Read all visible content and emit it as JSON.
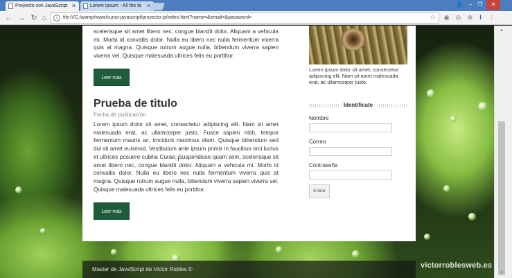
{
  "browser": {
    "tabs": [
      {
        "label": "Proyecto con JavaScript"
      },
      {
        "label": "Lorem Ipsum - All the fa"
      }
    ],
    "url": "file:///C:/wamp/www/curso-javascript/proyecto-js/index.html?name=&email=&password="
  },
  "post1": {
    "excerpt": "scelerisque sit amet libero nec, congue blandit dolor. Aliquam a vehicula mi. Morbi id convallis dolor. Nulla eu libero nec nulla fermentum viverra quis at magna. Quisque rutrum augue nulla, bibendum viverra sapien viverra vel. Quisque malesuada ultrices felis eu porttitor.",
    "button": "Leer más"
  },
  "post2": {
    "title": "Prueba de titulo",
    "date": "Fecha de publicación",
    "body": "Lorem ipsum dolor sit amet, consectetur adipiscing elit. Nam sit amet malesuada erat, ac ullamcorper justo. Fusce sapien nibh, tempor fermentum mauris ac, tincidunt maximus diam. Quisque bibendum sed dui sit amet euismod. Vestibulum ante ipsum primis in faucibus orci luctus et ultrices posuere cubilia Curae; Suspendisse quam sem, scelerisque sit amet libero nec, congue blandit dolor. Aliquam a vehicula mi. Morbi id convallis dolor. Nulla eu libero nec nulla fermentum viverra quis at magna. Quisque rutrum augue nulla, bibendum viverra sapien viverra vel. Quisque malesuada ultrices felis eu porttitor.",
    "button": "Leer más"
  },
  "sidebar": {
    "image_caption": "Lorem ipsum dolor sit amet, consectetur adipiscing elit. Nam sit amet malesuada erat, ac ullamcorper justo.",
    "login": {
      "title": "Identificate",
      "name_label": "Nombre",
      "email_label": "Correo",
      "password_label": "Contraseña",
      "submit": "Entrar"
    }
  },
  "footer": {
    "text": "Master de JavaScript de Víctor Robles ©"
  },
  "watermark": "victorroblesweb.es",
  "colors": {
    "button_green": "#1f5c3a",
    "chrome_blue": "#4b7dbf"
  }
}
